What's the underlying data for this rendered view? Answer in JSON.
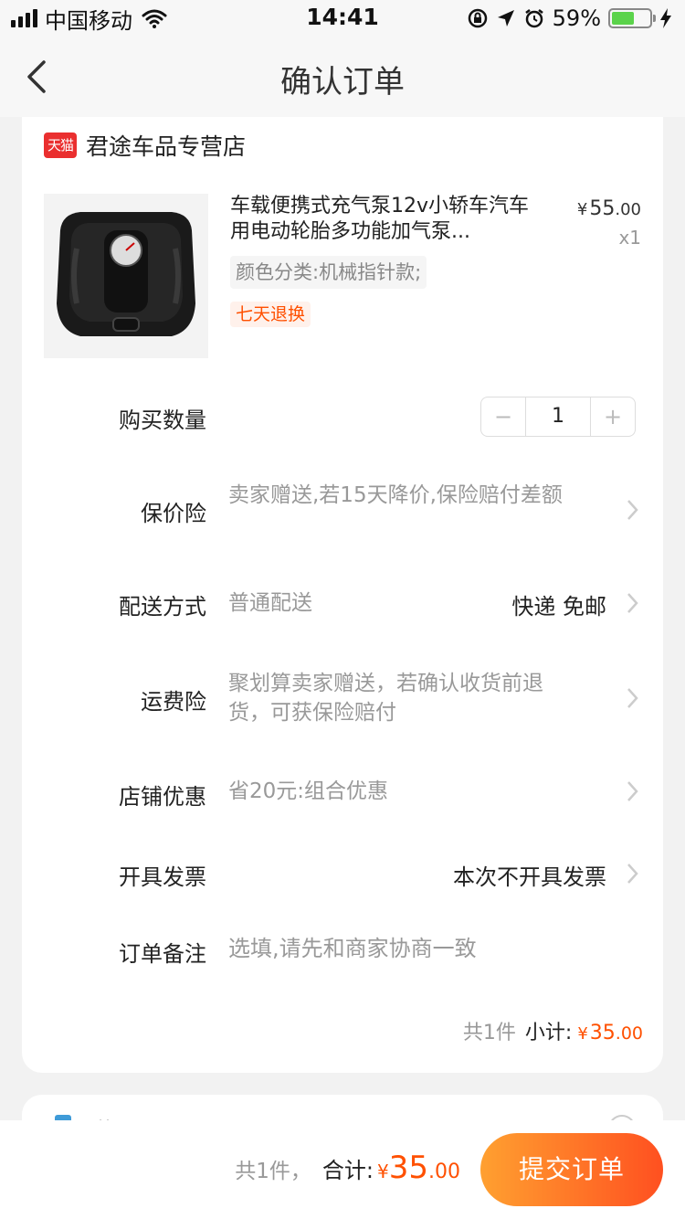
{
  "status_bar": {
    "carrier": "中国移动",
    "time": "14:41",
    "battery_pct": "59%",
    "battery_level": 0.59
  },
  "nav": {
    "title": "确认订单"
  },
  "shop": {
    "badge": "天猫",
    "name": "君途车品专营店"
  },
  "product": {
    "title": "车载便携式充气泵12v小轿车汽车用电动轮胎多功能加气泵...",
    "price_currency": "¥",
    "price_int": "55",
    "price_dec": ".00",
    "quantity": "x1",
    "sku": "颜色分类:机械指针款;",
    "service_tag": "七天退换"
  },
  "fields": {
    "quantity": {
      "label": "购买数量",
      "minus": "−",
      "value": "1",
      "plus": "+"
    },
    "price_protect": {
      "label": "保价险",
      "value": "卖家赠送,若15天降价,保险赔付差额"
    },
    "delivery": {
      "label": "配送方式",
      "value": "普通配送",
      "right": "快递 免邮"
    },
    "shipping_ins": {
      "label": "运费险",
      "value": "聚划算卖家赠送，若确认收货前退货，可获保险赔付"
    },
    "shop_discount": {
      "label": "店铺优惠",
      "value": "省20元:组合优惠"
    },
    "invoice": {
      "label": "开具发票",
      "right": "本次不开具发票"
    },
    "note": {
      "label": "订单备注",
      "placeholder": "选填,请先和商家协商一致"
    }
  },
  "subtotal": {
    "count": "共1件",
    "label": "小计:",
    "currency": "¥",
    "int": "35",
    "dec": ".00"
  },
  "next_section": {
    "label": "花呗分期"
  },
  "bottom": {
    "count": "共1件，",
    "label": "合计:",
    "currency": "¥",
    "int": "35",
    "dec": ".00",
    "submit": "提交订单"
  },
  "colors": {
    "accent": "#ff5000",
    "tmall_red": "#ea2f2f",
    "button_gradient_start": "#ffa030",
    "button_gradient_end": "#ff5020"
  }
}
